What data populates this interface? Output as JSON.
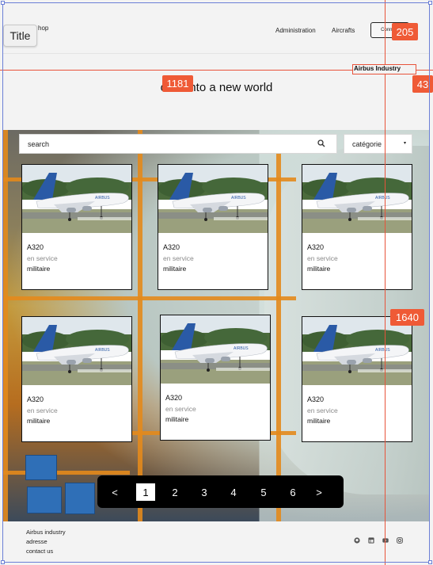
{
  "header": {
    "brand": "hop",
    "title_chip": "Title",
    "nav": [
      "Administration",
      "Aircrafts"
    ],
    "connect_label": "Conne..."
  },
  "hero": {
    "heading": "ome into a new world"
  },
  "annotations": {
    "selected_label": "Airbus Industry",
    "tags": [
      "205",
      "1181",
      "43",
      "1640"
    ]
  },
  "search": {
    "placeholder": "search",
    "category_label": "catégorie",
    "chevron": "▾"
  },
  "cards": [
    {
      "model": "A320",
      "status": "en service",
      "type": "militaire"
    },
    {
      "model": "A320",
      "status": "en service",
      "type": "militaire"
    },
    {
      "model": "A320",
      "status": "en service",
      "type": "militaire"
    },
    {
      "model": "A320",
      "status": "en service",
      "type": "militaire"
    },
    {
      "model": "A320",
      "status": "en service",
      "type": "militaire"
    },
    {
      "model": "A320",
      "status": "en service",
      "type": "militaire"
    }
  ],
  "pagination": {
    "prev": "<",
    "pages": [
      "1",
      "2",
      "3",
      "4",
      "5",
      "6"
    ],
    "next": ">",
    "current": "1"
  },
  "footer": {
    "lines": [
      "Airbus industry",
      "adresse",
      "contact us"
    ],
    "social_icons": [
      "github-icon",
      "linkedin-icon",
      "youtube-icon",
      "instagram-icon"
    ]
  },
  "colors": {
    "accent": "#ef5a36",
    "pager_bg": "#000000",
    "frame": "#6b7fd6"
  }
}
